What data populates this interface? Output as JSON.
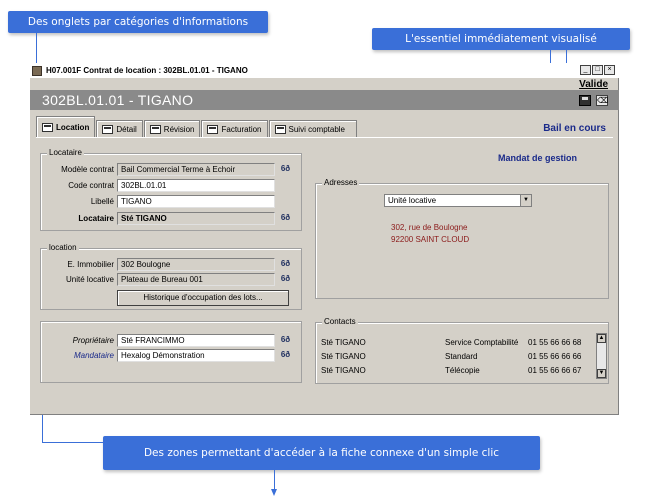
{
  "callouts": {
    "tabs_note": "Des onglets par catégories d'informations",
    "summary_note": "L'essentiel immédiatement visualisé",
    "links_note": "Des zones permettant d'accéder à la fiche connexe d'un simple clic"
  },
  "window": {
    "title": "H07.001F   Contrat de location : 302BL.01.01  -  TIGANO",
    "valide_label": "Valide",
    "banner": "302BL.01.01   -   TIGANO",
    "status": "Bail en cours",
    "mandat": "Mandat de gestion"
  },
  "tabs": [
    {
      "label": "Location"
    },
    {
      "label": "Détail"
    },
    {
      "label": "Révision"
    },
    {
      "label": "Facturation"
    },
    {
      "label": "Suivi comptable"
    }
  ],
  "locataire": {
    "legend": "Locataire",
    "modele_label": "Modèle contrat",
    "modele_value": "Bail Commercial Terme à Echoir",
    "code_label": "Code contrat",
    "code_value": "302BL.01.01",
    "libelle_label": "Libellé",
    "libelle_value": "TIGANO",
    "locataire_label": "Locataire",
    "locataire_value": "Sté TIGANO"
  },
  "location": {
    "legend": "location",
    "immeuble_label": "E. Immobilier",
    "immeuble_value": "302 Boulogne",
    "unite_label": "Unité locative",
    "unite_value": "Plateau de Bureau 001",
    "historique_button": "Historique d'occupation des lots..."
  },
  "parties": {
    "proprietaire_label": "Propriétaire",
    "proprietaire_value": "Sté FRANCIMMO",
    "mandataire_label": "Mandataire",
    "mandataire_value": "Hexalog Démonstration"
  },
  "adresses": {
    "legend": "Adresses",
    "select_value": "Unité locative",
    "line1": "302, rue de Boulogne",
    "line2": "92200  SAINT CLOUD"
  },
  "contacts": {
    "legend": "Contacts",
    "rows": [
      {
        "name": "Sté TIGANO",
        "service": "Service Comptabilité",
        "phone": "01 55 66 66 68"
      },
      {
        "name": "Sté TIGANO",
        "service": "Standard",
        "phone": "01 55 66 66 66"
      },
      {
        "name": "Sté TIGANO",
        "service": "Télécopie",
        "phone": "01 55 66 66 67"
      }
    ]
  },
  "link_glyph": "6ð",
  "colors": {
    "callout": "#3a6fd8",
    "status_text": "#1a2a8a",
    "address_text": "#8b1a1a"
  }
}
